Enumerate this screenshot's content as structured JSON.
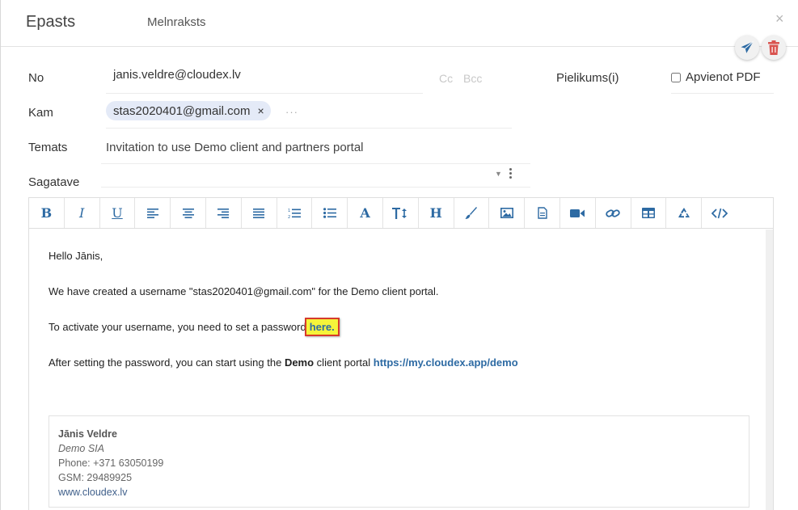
{
  "header": {
    "title": "Epasts",
    "draft_label": "Melnraksts",
    "close_glyph": "×"
  },
  "fields": {
    "from_label": "No",
    "from_value": "janis.veldre@cloudex.lv",
    "cc_label": "Cc",
    "bcc_label": "Bcc",
    "attachments_label": "Pielikums(i)",
    "merge_pdf_label": "Apvienot PDF",
    "merge_pdf_checked": false,
    "to_label": "Kam",
    "to_recipient": "stas2020401@gmail.com",
    "to_remove_glyph": "×",
    "to_more": "···",
    "subject_label": "Temats",
    "subject_value": "Invitation to use Demo client and partners portal",
    "template_label": "Sagatave",
    "template_value": ""
  },
  "toolbar": {
    "bold": "B",
    "italic": "I",
    "underline": "U",
    "font_color": "A",
    "heading": "H",
    "items": [
      "bold",
      "italic",
      "underline",
      "align-left",
      "align-center",
      "align-right",
      "justify",
      "ordered-list",
      "bullet-list",
      "font-color",
      "font-size",
      "heading",
      "paint-brush",
      "image",
      "document",
      "video",
      "link",
      "table",
      "recycle",
      "code-view"
    ]
  },
  "body": {
    "greeting": "Hello Jānis,",
    "line1": "We have created a username \"stas2020401@gmail.com\" for the Demo client portal.",
    "line2_prefix": "To activate your username, you need to set a password",
    "line2_link": "here.",
    "line3_prefix": "After setting the password, you can start using the ",
    "line3_bold": "Demo",
    "line3_mid": " client portal ",
    "line3_link": "https://my.cloudex.app/demo"
  },
  "signature": {
    "name": "Jānis Veldre",
    "company": "Demo SIA",
    "phone": "Phone: +371 63050199",
    "gsm": "GSM: 29489925",
    "web": "www.cloudex.lv"
  },
  "colors": {
    "accent": "#2d6aa3",
    "delete": "#d9534f",
    "chip_bg": "#e4eaf7",
    "highlight_bg": "#f6f43a",
    "highlight_border": "#d63a2b"
  }
}
